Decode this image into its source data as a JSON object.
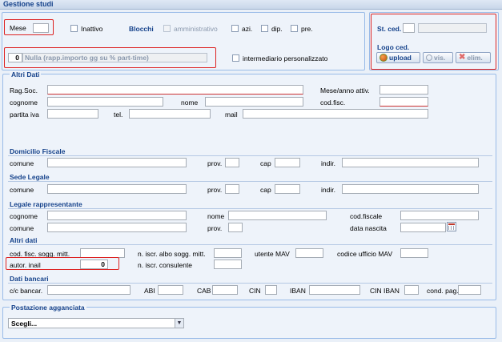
{
  "window": {
    "title": "Gestione studi"
  },
  "top_panel": {
    "mese_label": "Mese",
    "inattivo_label": "Inattivo",
    "blocchi_link": "Blocchi",
    "amministrativo_label": "amministrativo",
    "azi_label": "azi.",
    "dip_label": "dip.",
    "pre_label": "pre.",
    "nulla_value": "0",
    "nulla_text": "Nulla (rapp.importo gg su % part-time)",
    "intermediario_label": "intermediario personalizzato"
  },
  "right_panel": {
    "st_ced_label": "St. ced.",
    "logo_ced_label": "Logo ced.",
    "upload_label": "upload",
    "vis_label": "vis.",
    "elim_label": "elim."
  },
  "altri_dati": {
    "legend": "Altri Dati",
    "rag_soc": "Rag.Soc.",
    "mese_anno": "Mese/anno attiv.",
    "cognome": "cognome",
    "nome": "nome",
    "cod_fisc": "cod.fisc.",
    "partita_iva": "partita iva",
    "tel": "tel.",
    "mail": "mail"
  },
  "domicilio": {
    "title": "Domicilio Fiscale",
    "comune": "comune",
    "prov": "prov.",
    "cap": "cap",
    "indir": "indir."
  },
  "sede": {
    "title": "Sede Legale",
    "comune": "comune",
    "prov": "prov.",
    "cap": "cap",
    "indir": "indir."
  },
  "legale": {
    "title": "Legale rappresentante",
    "cognome": "cognome",
    "nome": "nome",
    "cod_fiscale": "cod.fiscale",
    "comune": "comune",
    "prov": "prov.",
    "data_nascita": "data nascita"
  },
  "altri": {
    "title": "Altri dati",
    "cod_fisc_sogg": "cod. fisc. sogg. mitt.",
    "n_iscr_albo": "n. iscr. albo sogg. mitt.",
    "utente_mav": "utente MAV",
    "codice_ufficio": "codice ufficio MAV",
    "autor_inail": "autor. inail",
    "autor_inail_value": "0",
    "n_iscr_consulente": "n. iscr. consulente"
  },
  "bancari": {
    "title": "Dati bancari",
    "cc": "c/c bancar.",
    "abi": "ABI",
    "cab": "CAB",
    "cin": "CIN",
    "iban": "IBAN",
    "cin_iban": "CIN IBAN",
    "cond_pag": "cond. pag."
  },
  "postazione": {
    "legend": "Postazione agganciata",
    "select_value": "Scegli..."
  }
}
